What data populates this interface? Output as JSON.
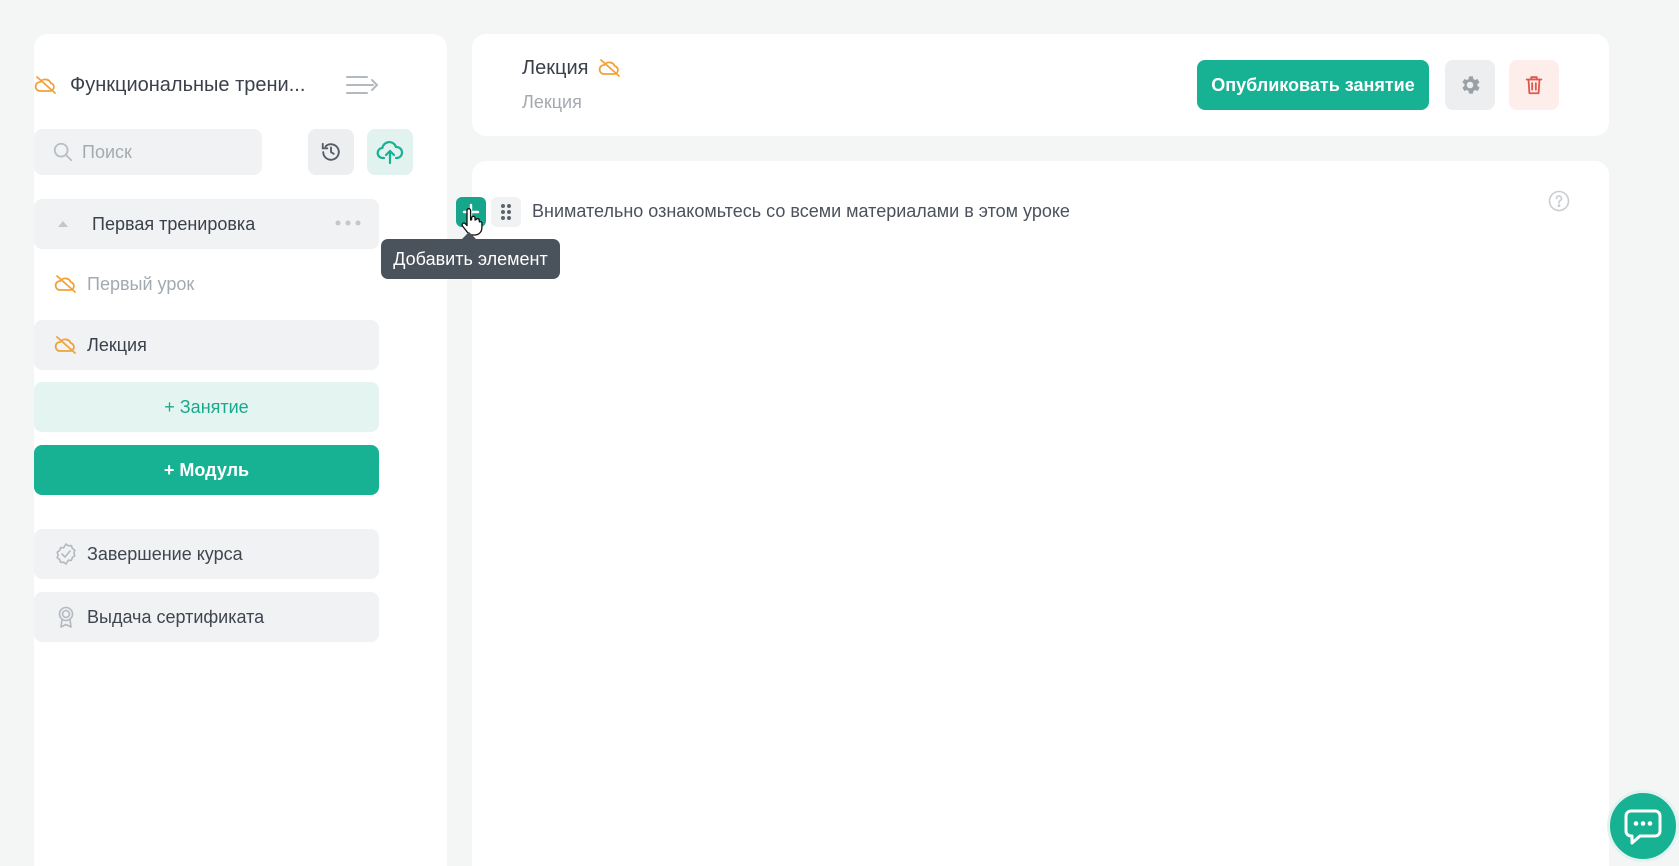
{
  "sidebar": {
    "course_title": "Функциональные трени...",
    "search_placeholder": "Поиск",
    "module": {
      "label": "Первая тренировка"
    },
    "lessons": [
      {
        "label": "Первый урок",
        "state": "hidden"
      },
      {
        "label": "Лекция",
        "state": "hidden"
      }
    ],
    "add_lesson_label": "+ Занятие",
    "add_module_label": "+ Модуль",
    "finish_label": "Завершение курса",
    "certificate_label": "Выдача сертификата"
  },
  "header": {
    "title": "Лекция",
    "subtitle": "Лекция",
    "publish_label": "Опубликовать занятие"
  },
  "content": {
    "block_text": "Внимательно ознакомьтесь со всеми материалами в этом уроке",
    "tooltip": "Добавить элемент"
  },
  "colors": {
    "accent": "#17b193",
    "hidden_icon": "#f0a23b",
    "danger": "#e0584a"
  },
  "icons": [
    "hidden-eye-icon",
    "collapse-menu-icon",
    "search-icon",
    "history-icon",
    "cloud-upload-icon",
    "more-dots-icon",
    "check-badge-icon",
    "certificate-icon",
    "gear-icon",
    "trash-icon",
    "plus-icon",
    "drag-handle-icon",
    "help-icon",
    "chat-icon"
  ]
}
